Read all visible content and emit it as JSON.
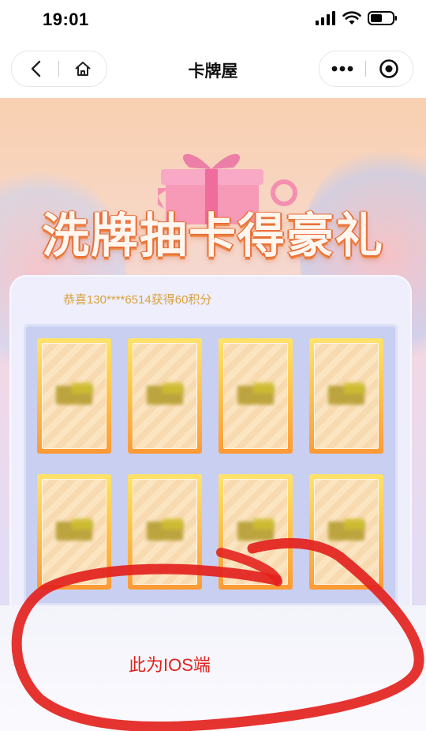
{
  "status_bar": {
    "time": "19:01"
  },
  "nav": {
    "title": "卡牌屋"
  },
  "banner": {
    "title": "洗牌抽卡得豪礼"
  },
  "panel": {
    "congrats_text": "恭喜130****6514获得60积分"
  },
  "cards": [
    {
      "row": 1,
      "col": 1
    },
    {
      "row": 1,
      "col": 2
    },
    {
      "row": 1,
      "col": 3
    },
    {
      "row": 1,
      "col": 4
    },
    {
      "row": 2,
      "col": 1
    },
    {
      "row": 2,
      "col": 2
    },
    {
      "row": 2,
      "col": 3
    },
    {
      "row": 2,
      "col": 4
    }
  ],
  "annotation": {
    "text": "此为IOS端",
    "color": "#e0221c"
  },
  "colors": {
    "card_gold": "#ffc44e",
    "card_orange": "#ff9a35",
    "congrats": "#d9a23c"
  }
}
